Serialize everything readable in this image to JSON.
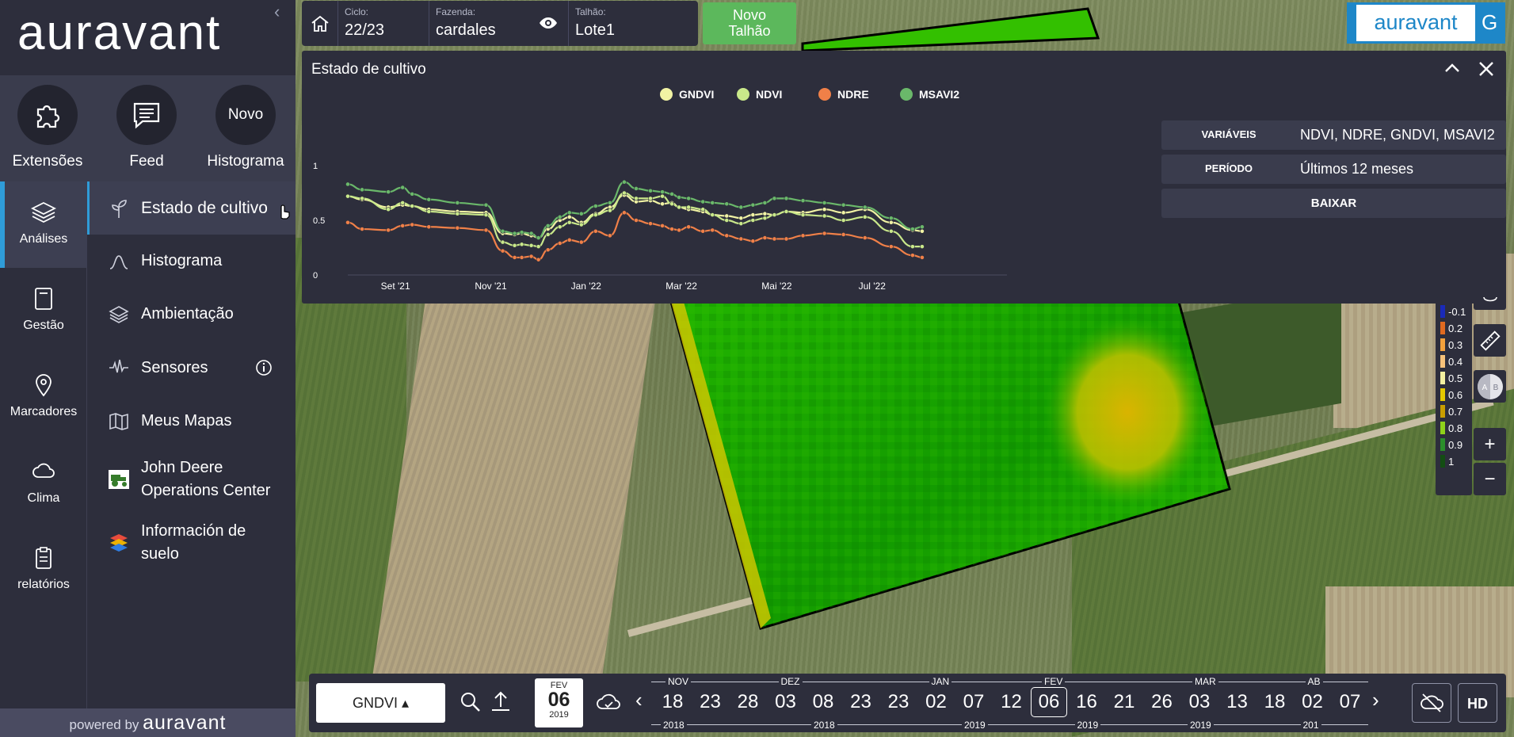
{
  "brand": {
    "logo_text": "auravant",
    "powered_prefix": "powered by",
    "powered_brand": "auravant",
    "badge_text": "auravant",
    "badge_letter": "G"
  },
  "quick_actions": [
    {
      "label": "Extensões",
      "icon": "puzzle-icon"
    },
    {
      "label": "Feed",
      "icon": "chat-icon"
    },
    {
      "label": "Histograma",
      "circle_text": "Novo"
    }
  ],
  "rail": [
    {
      "label": "Análises",
      "icon": "layers-icon",
      "active": true
    },
    {
      "label": "Gestão",
      "icon": "notebook-icon"
    },
    {
      "label": "Marcadores",
      "icon": "pin-icon"
    },
    {
      "label": "Clima",
      "icon": "cloud-icon"
    },
    {
      "label": "relatórios",
      "icon": "clipboard-icon"
    }
  ],
  "subnav": [
    {
      "label": "Estado de cultivo",
      "icon": "plant-icon",
      "active": true
    },
    {
      "label": "Histograma",
      "icon": "bell-curve-icon"
    },
    {
      "label": "Ambientação",
      "icon": "layers-icon"
    },
    {
      "label": "Sensores",
      "icon": "signal-icon",
      "extra": "info-icon"
    },
    {
      "label": "Meus Mapas",
      "icon": "map-icon"
    },
    {
      "label": "John Deere Operations Center",
      "icon": "tractor-icon"
    },
    {
      "label": "Información de suelo",
      "icon": "stack-icon"
    }
  ],
  "topbar": {
    "cycle_label": "Ciclo:",
    "cycle_value": "22/23",
    "farm_label": "Fazenda:",
    "farm_value": "cardales",
    "plot_label": "Talhão:",
    "plot_value": "Lote1",
    "new_plot_line1": "Novo",
    "new_plot_line2": "Talhão"
  },
  "panel": {
    "title": "Estado de cultivo",
    "variables_label": "VARIÁVEIS",
    "variables_value": "NDVI, NDRE, GNDVI, MSAVI2",
    "period_label": "PERÍODO",
    "period_value": "Últimos 12 meses",
    "download_label": "BAIXAR"
  },
  "chart_data": {
    "type": "line",
    "title": "",
    "xlabel": "",
    "ylabel": "",
    "ylim": [
      0,
      1
    ],
    "yticks": [
      "0",
      "0.5",
      "1"
    ],
    "xticks": [
      "Set '21",
      "Nov '21",
      "Jan '22",
      "Mar '22",
      "Mai '22",
      "Jul '22"
    ],
    "xtick_positions": [
      1,
      3,
      5,
      7,
      9,
      11
    ],
    "x": [
      0.0,
      0.3,
      0.85,
      1.15,
      1.35,
      1.7,
      2.3,
      2.9,
      3.25,
      3.5,
      3.65,
      3.85,
      4.0,
      4.2,
      4.45,
      4.65,
      4.9,
      5.2,
      5.5,
      5.8,
      6.05,
      6.35,
      6.6,
      6.8,
      6.95,
      7.15,
      7.45,
      7.65,
      7.95,
      8.25,
      8.5,
      8.75,
      8.95,
      9.2,
      9.55,
      10.0,
      10.4,
      10.85,
      11.4,
      11.85,
      12.05
    ],
    "series": [
      {
        "name": "GNDVI",
        "color": "#f1f3a4",
        "values": [
          0.72,
          0.69,
          0.62,
          0.64,
          0.63,
          0.6,
          0.58,
          0.57,
          0.38,
          0.37,
          0.38,
          0.36,
          0.34,
          0.42,
          0.5,
          0.53,
          0.48,
          0.56,
          0.62,
          0.73,
          0.67,
          0.68,
          0.65,
          0.66,
          0.62,
          0.6,
          0.58,
          0.55,
          0.54,
          0.52,
          0.55,
          0.56,
          0.55,
          0.58,
          0.57,
          0.6,
          0.57,
          0.6,
          0.48,
          0.41,
          0.4
        ]
      },
      {
        "name": "NDVI",
        "color": "#c9e88a",
        "values": [
          0.72,
          0.7,
          0.6,
          0.66,
          0.63,
          0.58,
          0.56,
          0.55,
          0.3,
          0.27,
          0.28,
          0.27,
          0.26,
          0.37,
          0.44,
          0.48,
          0.46,
          0.55,
          0.59,
          0.75,
          0.7,
          0.7,
          0.72,
          0.65,
          0.62,
          0.62,
          0.6,
          0.55,
          0.5,
          0.47,
          0.5,
          0.52,
          0.55,
          0.58,
          0.55,
          0.54,
          0.5,
          0.53,
          0.4,
          0.26,
          0.26
        ]
      },
      {
        "name": "NDRE",
        "color": "#f08048",
        "values": [
          0.48,
          0.42,
          0.41,
          0.45,
          0.46,
          0.44,
          0.43,
          0.41,
          0.22,
          0.16,
          0.16,
          0.17,
          0.14,
          0.23,
          0.29,
          0.32,
          0.3,
          0.4,
          0.36,
          0.57,
          0.5,
          0.47,
          0.45,
          0.42,
          0.41,
          0.44,
          0.4,
          0.41,
          0.36,
          0.33,
          0.31,
          0.34,
          0.33,
          0.33,
          0.36,
          0.38,
          0.37,
          0.34,
          0.26,
          0.18,
          0.16
        ]
      },
      {
        "name": "MSAVI2",
        "color": "#6ab86a",
        "values": [
          0.83,
          0.78,
          0.76,
          0.8,
          0.74,
          0.69,
          0.66,
          0.64,
          0.4,
          0.38,
          0.39,
          0.38,
          0.34,
          0.45,
          0.53,
          0.57,
          0.56,
          0.63,
          0.66,
          0.85,
          0.79,
          0.77,
          0.76,
          0.74,
          0.71,
          0.7,
          0.67,
          0.66,
          0.65,
          0.62,
          0.64,
          0.66,
          0.7,
          0.7,
          0.68,
          0.66,
          0.64,
          0.62,
          0.52,
          0.42,
          0.44
        ]
      }
    ]
  },
  "legend": {
    "values": [
      "-0.1",
      "0.2",
      "0.3",
      "0.4",
      "0.5",
      "0.6",
      "0.7",
      "0.8",
      "0.9",
      "1"
    ],
    "colors": [
      "#1a2ab8",
      "#e06a20",
      "#f2a13c",
      "#f7c27a",
      "#f3f0a0",
      "#e4c800",
      "#c99e00",
      "#8fd11a",
      "#2b8f2b",
      "#134d13"
    ]
  },
  "tools": {
    "ruler": "ruler-icon",
    "ab": "A B",
    "zoom_in": "+",
    "zoom_out": "−"
  },
  "timeline": {
    "index_value": "GNDVI ▴",
    "selected_month": "FEV",
    "selected_day": "06",
    "selected_year": "2019",
    "months": [
      {
        "label": "NOV",
        "pos": 0
      },
      {
        "label": "DEZ",
        "pos": 3
      },
      {
        "label": "JAN",
        "pos": 7
      },
      {
        "label": "FEV",
        "pos": 10
      },
      {
        "label": "MAR",
        "pos": 14
      },
      {
        "label": "AB",
        "pos": 17
      }
    ],
    "years": [
      {
        "label": "2018",
        "pos": 0
      },
      {
        "label": "2018",
        "pos": 4
      },
      {
        "label": "2019",
        "pos": 8
      },
      {
        "label": "2019",
        "pos": 11
      },
      {
        "label": "2019",
        "pos": 14
      },
      {
        "label": "201",
        "pos": 17
      }
    ],
    "dates": [
      "18",
      "23",
      "28",
      "03",
      "08",
      "23",
      "23",
      "02",
      "07",
      "12",
      "06",
      "16",
      "21",
      "26",
      "03",
      "13",
      "18",
      "02",
      "07"
    ],
    "selected_index": 10,
    "hd_label": "HD"
  }
}
